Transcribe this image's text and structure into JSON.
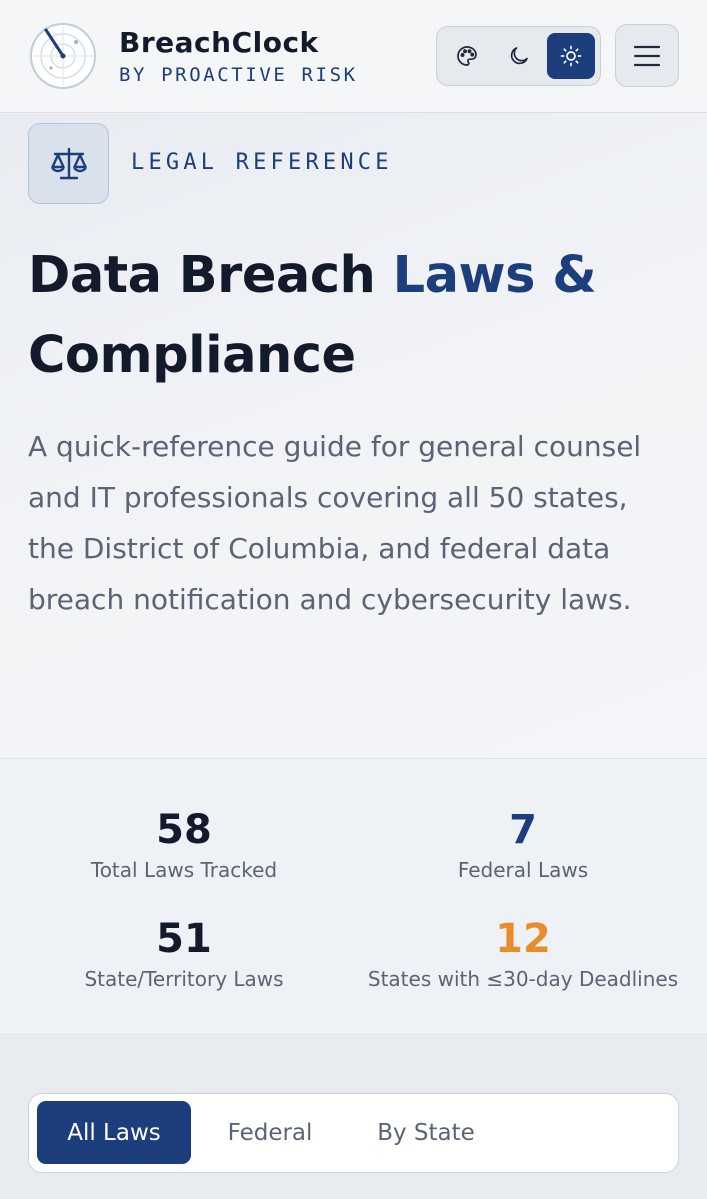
{
  "header": {
    "brand_name": "BreachClock",
    "brand_sub": "BY PROACTIVE RISK",
    "theme_options": [
      {
        "name": "palette-icon",
        "active": false
      },
      {
        "name": "moon-icon",
        "active": false
      },
      {
        "name": "sun-icon",
        "active": true
      }
    ],
    "menu_icon": "hamburger-menu-icon"
  },
  "hero": {
    "eyebrow_icon": "scales-icon",
    "eyebrow": "LEGAL REFERENCE",
    "title_part1": "Data Breach ",
    "title_accent": "Laws &",
    "title_part2": "Compliance",
    "description": "A quick-reference guide for general counsel and IT professionals covering all 50 states, the District of Columbia, and federal data breach notification and cybersecurity laws."
  },
  "stats": [
    {
      "value": "58",
      "label": "Total Laws Tracked",
      "color": "#121a2b"
    },
    {
      "value": "7",
      "label": "Federal Laws",
      "color": "#1c3e7c"
    },
    {
      "value": "51",
      "label": "State/Territory Laws",
      "color": "#121a2b"
    },
    {
      "value": "12",
      "label": "States with ≤30-day Deadlines",
      "color": "#e98c2a"
    }
  ],
  "filter_tabs": [
    {
      "label": "All Laws",
      "active": true
    },
    {
      "label": "Federal",
      "active": false
    },
    {
      "label": "By State",
      "active": false
    }
  ],
  "colors": {
    "accent": "#1c3e7c",
    "warning": "#e98c2a",
    "text": "#121a2b",
    "muted": "#5b6475"
  }
}
